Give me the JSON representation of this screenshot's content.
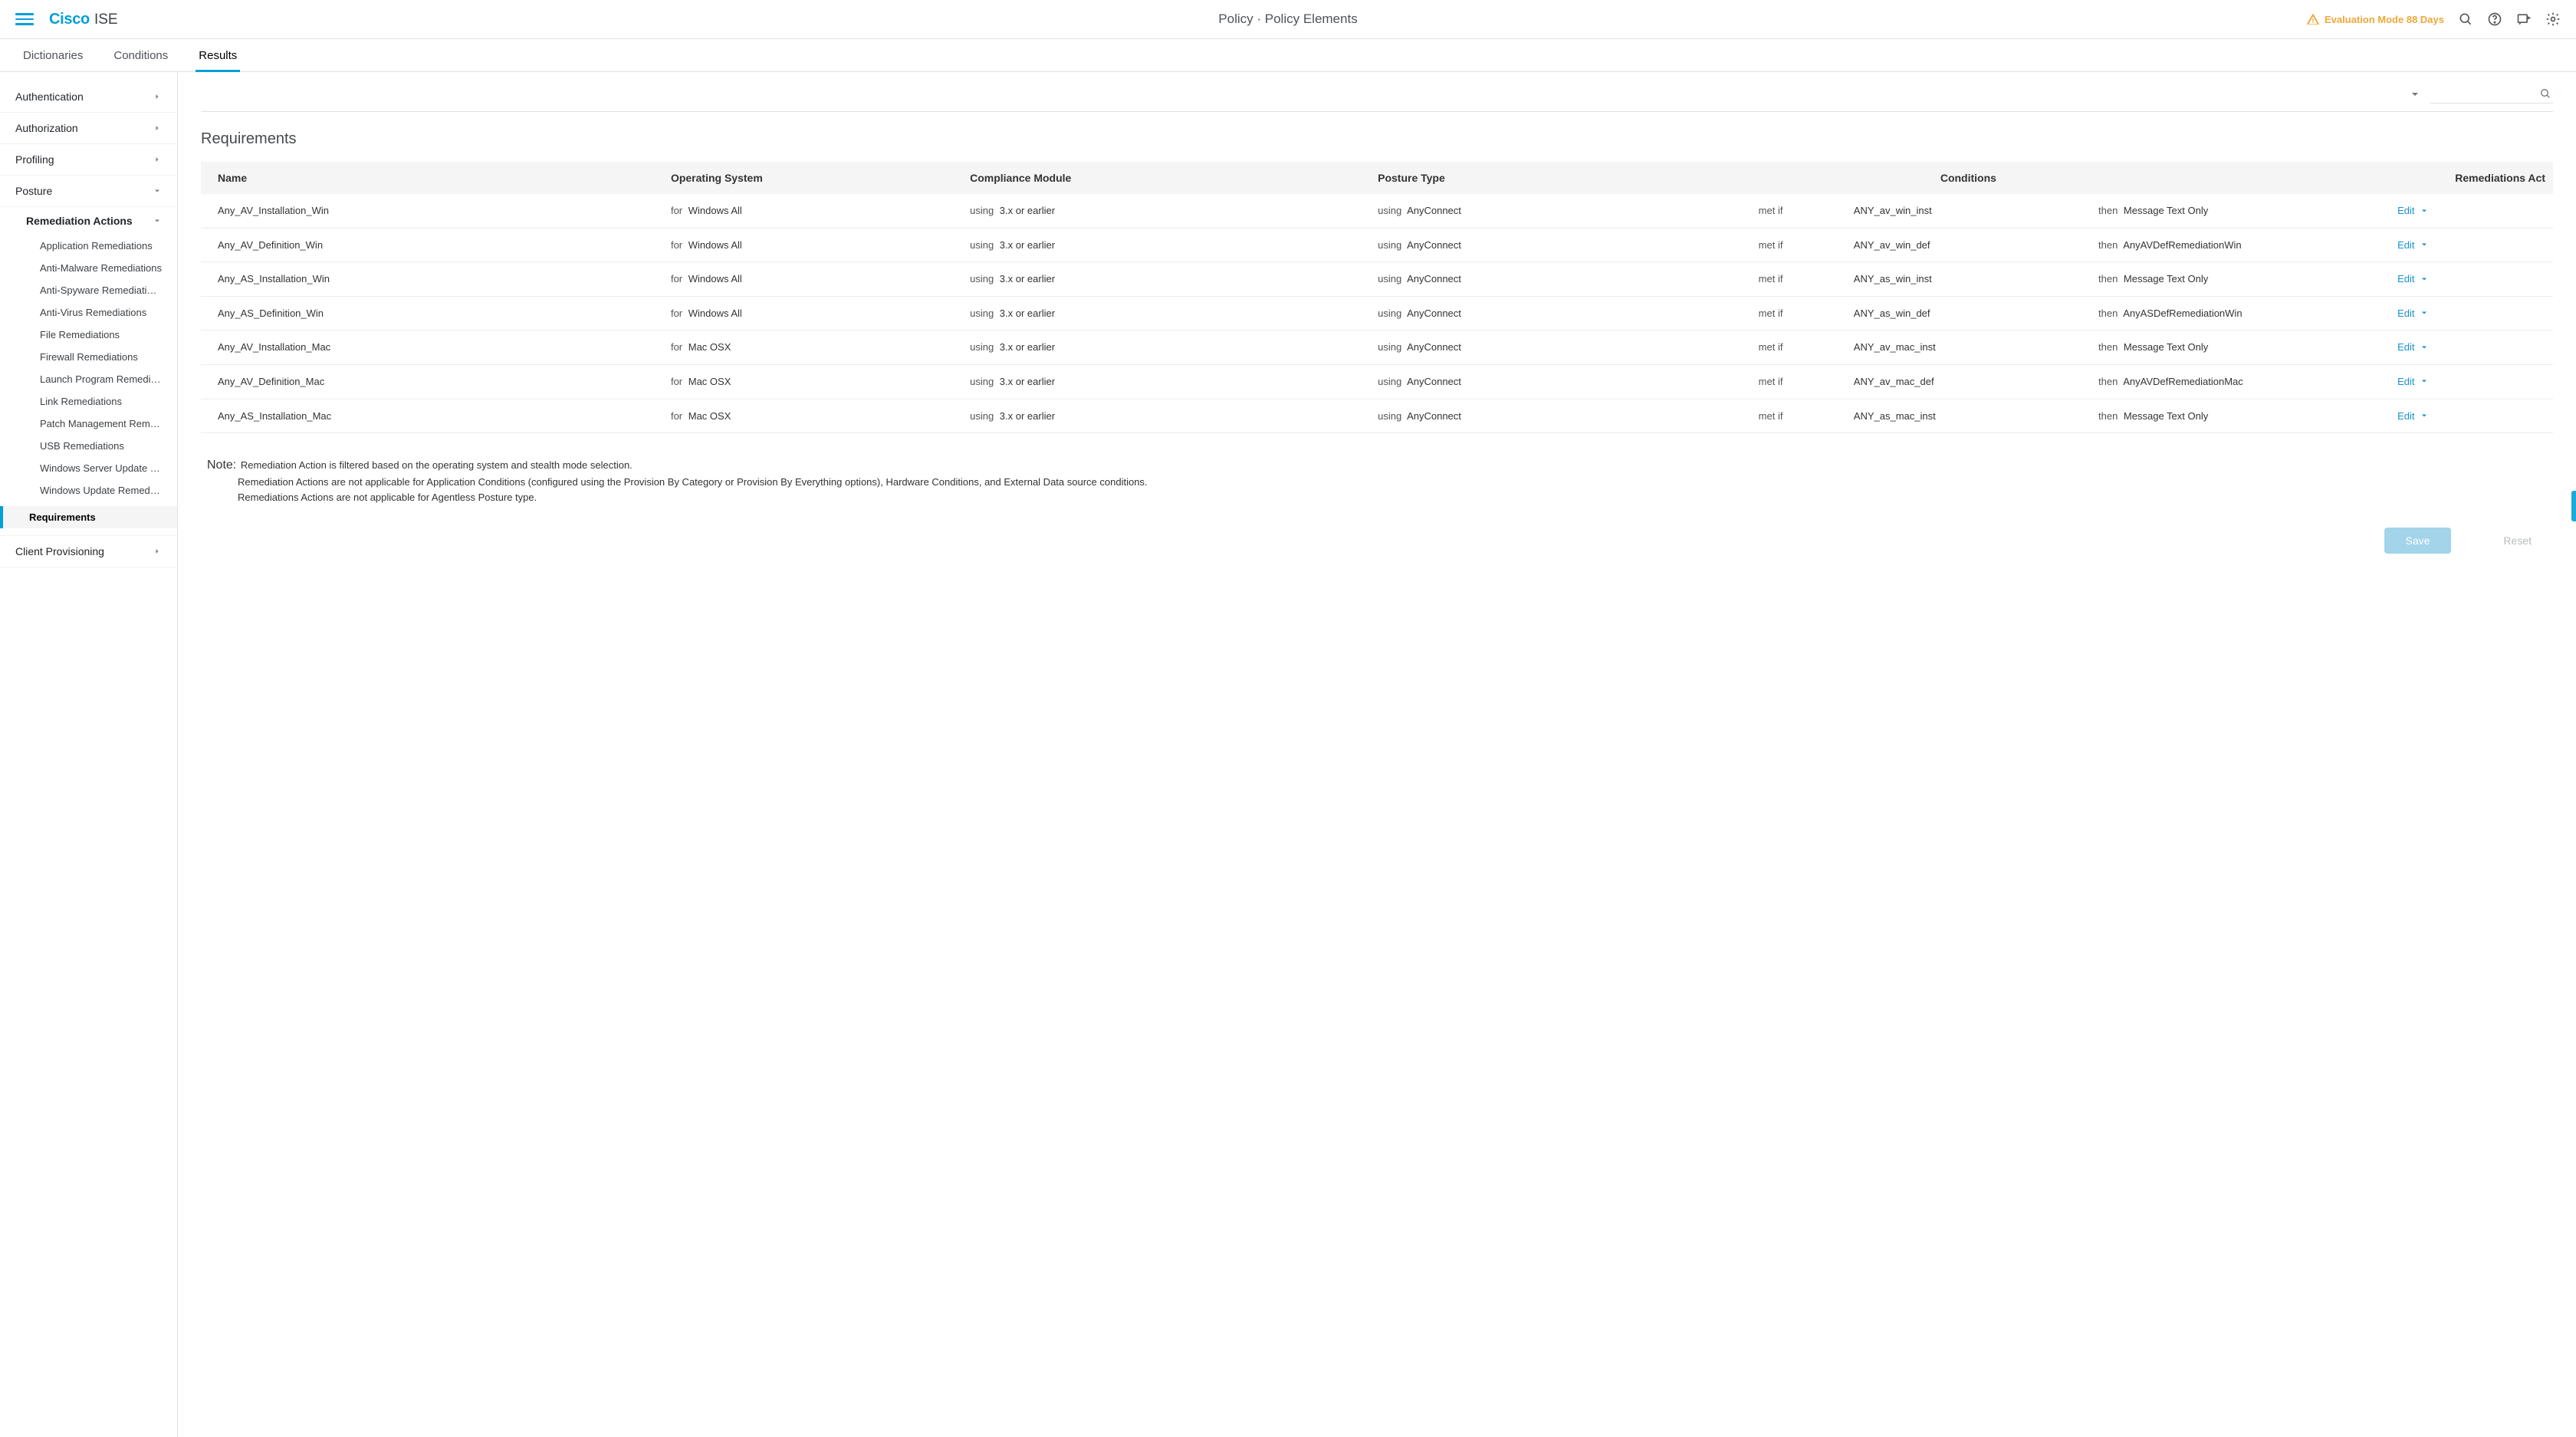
{
  "topbar": {
    "brand_cisco": "Cisco",
    "brand_ise": "ISE",
    "breadcrumb": "Policy · Policy Elements",
    "eval_text": "Evaluation Mode 88 Days"
  },
  "tabs": {
    "dictionaries": "Dictionaries",
    "conditions": "Conditions",
    "results": "Results"
  },
  "sidebar": {
    "authentication": "Authentication",
    "authorization": "Authorization",
    "profiling": "Profiling",
    "posture": "Posture",
    "remediation_actions": "Remediation Actions",
    "leaves": {
      "application": "Application Remediations",
      "antimalware": "Anti-Malware Remediations",
      "antispyware": "Anti-Spyware Remediations",
      "antivirus": "Anti-Virus Remediations",
      "file": "File Remediations",
      "firewall": "Firewall Remediations",
      "launch": "Launch Program Remediati...",
      "link": "Link Remediations",
      "patch": "Patch Management Remed...",
      "usb": "USB Remediations",
      "wsus": "Windows Server Update S...",
      "winupdate": "Windows Update Remedia..."
    },
    "requirements": "Requirements",
    "client_provisioning": "Client Provisioning"
  },
  "section": {
    "title": "Requirements"
  },
  "table": {
    "headers": {
      "name": "Name",
      "os": "Operating System",
      "compliance": "Compliance Module",
      "posture": "Posture Type",
      "conditions": "Conditions",
      "remediations": "Remediations Act"
    },
    "prefix": {
      "for": "for",
      "using": "using",
      "using_ac": "using",
      "metif": "met if",
      "then": "then"
    },
    "edit_label": "Edit",
    "rows": [
      {
        "name": "Any_AV_Installation_Win",
        "os": "Windows All",
        "compliance": "3.x or earlier",
        "posture": "AnyConnect",
        "condition": "ANY_av_win_inst",
        "remediation": "Message Text Only"
      },
      {
        "name": "Any_AV_Definition_Win",
        "os": "Windows All",
        "compliance": "3.x or earlier",
        "posture": "AnyConnect",
        "condition": "ANY_av_win_def",
        "remediation": "AnyAVDefRemediationWin"
      },
      {
        "name": "Any_AS_Installation_Win",
        "os": "Windows All",
        "compliance": "3.x or earlier",
        "posture": "AnyConnect",
        "condition": "ANY_as_win_inst",
        "remediation": "Message Text Only"
      },
      {
        "name": "Any_AS_Definition_Win",
        "os": "Windows All",
        "compliance": "3.x or earlier",
        "posture": "AnyConnect",
        "condition": "ANY_as_win_def",
        "remediation": "AnyASDefRemediationWin"
      },
      {
        "name": "Any_AV_Installation_Mac",
        "os": "Mac OSX",
        "compliance": "3.x or earlier",
        "posture": "AnyConnect",
        "condition": "ANY_av_mac_inst",
        "remediation": "Message Text Only"
      },
      {
        "name": "Any_AV_Definition_Mac",
        "os": "Mac OSX",
        "compliance": "3.x or earlier",
        "posture": "AnyConnect",
        "condition": "ANY_av_mac_def",
        "remediation": "AnyAVDefRemediationMac"
      },
      {
        "name": "Any_AS_Installation_Mac",
        "os": "Mac OSX",
        "compliance": "3.x or earlier",
        "posture": "AnyConnect",
        "condition": "ANY_as_mac_inst",
        "remediation": "Message Text Only"
      }
    ]
  },
  "note": {
    "label": "Note:",
    "line1": "Remediation Action is filtered based on the operating system and stealth mode selection.",
    "line2": "Remediation Actions are not applicable for Application Conditions (configured using the Provision By Category or Provision By Everything options), Hardware Conditions, and External Data source conditions.",
    "line3": "Remediations Actions are not applicable for Agentless Posture type."
  },
  "footer": {
    "save": "Save",
    "reset": "Reset"
  }
}
